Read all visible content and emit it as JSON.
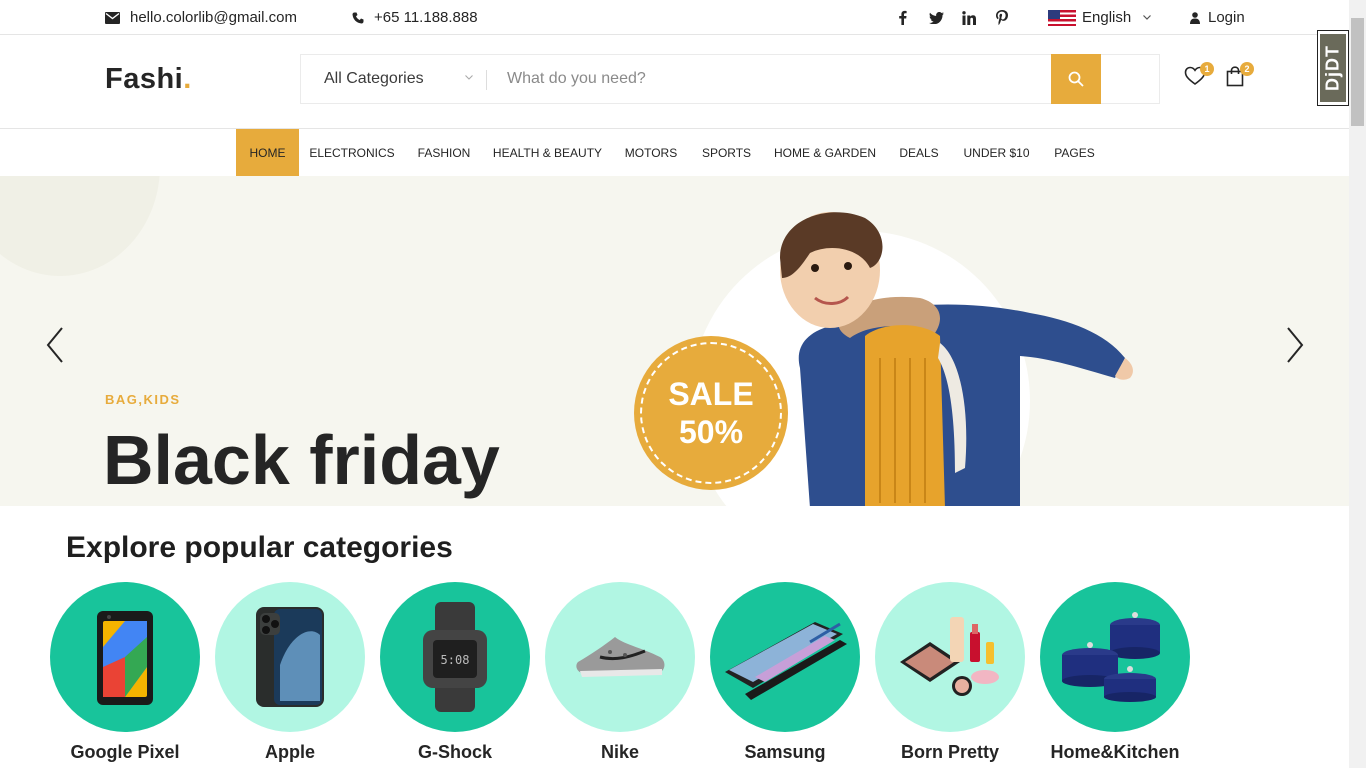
{
  "topbar": {
    "email": "hello.colorlib@gmail.com",
    "phone": "+65 11.188.888",
    "social": [
      "facebook-icon",
      "twitter-icon",
      "linkedin-icon",
      "pinterest-icon"
    ],
    "language": "English",
    "login": "Login"
  },
  "header": {
    "logo": "Fashi",
    "logo_dot": ".",
    "category_select": "All Categories",
    "search_placeholder": "What do you need?",
    "wishlist_count": "1",
    "cart_count": "2"
  },
  "nav": {
    "items": [
      "HOME",
      "ELECTRONICS",
      "FASHION",
      "HEALTH & BEAUTY",
      "MOTORS",
      "SPORTS",
      "HOME & GARDEN",
      "DEALS",
      "UNDER $10",
      "PAGES"
    ],
    "active": "HOME"
  },
  "hero": {
    "tag": "BAG,KIDS",
    "title": "Black friday",
    "sale_line1": "SALE",
    "sale_line2": "50%"
  },
  "categories": {
    "title": "Explore popular categories",
    "items": [
      "Google Pixel",
      "Apple",
      "G-Shock",
      "Nike",
      "Samsung",
      "Born Pretty",
      "Home&Kitchen"
    ]
  },
  "debug_toolbar": {
    "label": "DjDT"
  },
  "colors": {
    "accent": "#e7ab3c",
    "teal_dark": "#18c49b",
    "teal_light": "#b1f6e3",
    "hero_bg": "#f6f6ef"
  }
}
